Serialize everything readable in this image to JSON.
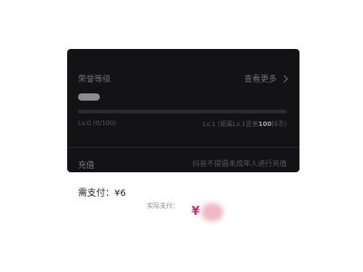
{
  "honor": {
    "title": "荣誉等级",
    "more_label": "查看更多",
    "progress_fraction": 0.0,
    "current_level_text": "Lv.0 (0/100)",
    "next_level_prefix": "Lv.1 (距离Lv.1还差",
    "next_level_amount": "100",
    "next_level_suffix": "抖币)"
  },
  "recharge": {
    "label": "充值",
    "notice": "抖音不提倡未成年人进行充值"
  },
  "payment": {
    "need_pay_label": "需支付：",
    "need_pay_amount": "¥6",
    "actual_pay_label": "实际支付：",
    "currency_symbol": "¥"
  }
}
